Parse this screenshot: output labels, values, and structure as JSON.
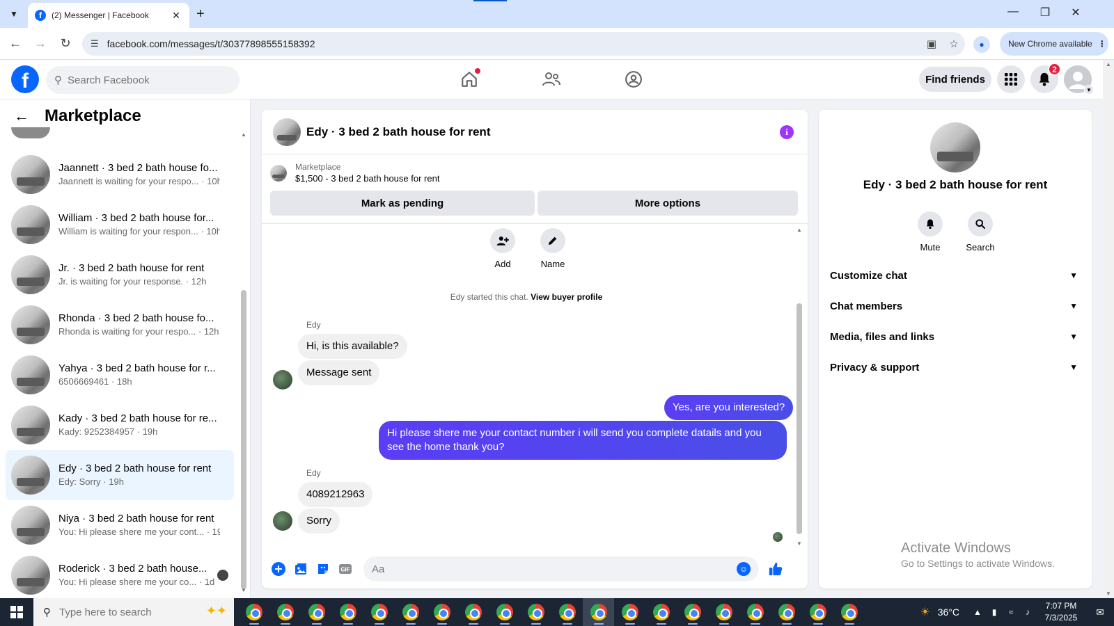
{
  "browser": {
    "tab_title": "(2) Messenger | Facebook",
    "url": "facebook.com/messages/t/30377898555158392",
    "update_label": "New Chrome available"
  },
  "fb": {
    "search_placeholder": "Search Facebook",
    "find_friends": "Find friends",
    "notification_count": "2"
  },
  "sidebar": {
    "title": "Marketplace",
    "conversations": [
      {
        "name": "Jaannett · 3 bed 2 bath house fo...",
        "preview": "Jaannett is waiting for your respo... · 10h"
      },
      {
        "name": "William · 3 bed 2 bath house for...",
        "preview": "William is waiting for your respon... · 10h"
      },
      {
        "name": "Jr. · 3 bed 2 bath house for rent",
        "preview": "Jr. is waiting for your response. · 12h"
      },
      {
        "name": "Rhonda · 3 bed 2 bath house fo...",
        "preview": "Rhonda is waiting for your respo... · 12h"
      },
      {
        "name": "Yahya · 3 bed 2 bath house for r...",
        "preview": "6506669461 · 18h"
      },
      {
        "name": "Kady · 3 bed 2 bath house for re...",
        "preview": "Kady: 9252384957 · 19h"
      },
      {
        "name": "Edy · 3 bed 2 bath house for rent",
        "preview": "Edy: Sorry · 19h"
      },
      {
        "name": "Niya · 3 bed 2 bath house for rent",
        "preview": "You: Hi please shere me your cont... · 19h"
      },
      {
        "name": "Roderick · 3 bed 2 bath house...",
        "preview": "You: Hi please shere me your co... · 1d"
      }
    ]
  },
  "chat": {
    "title": "Edy · 3 bed 2 bath house for rent",
    "listing_label": "Marketplace",
    "listing_price": "$1,500 - 3 bed 2 bath house for rent",
    "mark_pending": "Mark as pending",
    "more_options": "More options",
    "add_label": "Add",
    "name_label": "Name",
    "started_text": "Edy started this chat.",
    "view_profile": "View buyer profile",
    "sender": "Edy",
    "messages": {
      "m1": "Hi, is this available?",
      "m2": "Message sent",
      "m3": "Yes, are you interested?",
      "m4": "Hi please shere me your contact number i will send you complete datails and you see the home thank you?",
      "m5": "4089212963",
      "m6": "Sorry"
    },
    "composer_placeholder": "Aa"
  },
  "info": {
    "title": "Edy · 3 bed 2 bath house for rent",
    "mute": "Mute",
    "search": "Search",
    "sections": [
      "Customize chat",
      "Chat members",
      "Media, files and links",
      "Privacy & support"
    ]
  },
  "watermark": {
    "line1": "Activate Windows",
    "line2": "Go to Settings to activate Windows."
  },
  "taskbar": {
    "search_placeholder": "Type here to search",
    "temperature": "36°C",
    "time": "7:07 PM",
    "date": "7/3/2025"
  },
  "colors": {
    "fb_blue": "#0866ff",
    "outgoing_bubble": "#4f46e5",
    "info_purple": "#a033ff",
    "badge_red": "#e41e3f"
  }
}
